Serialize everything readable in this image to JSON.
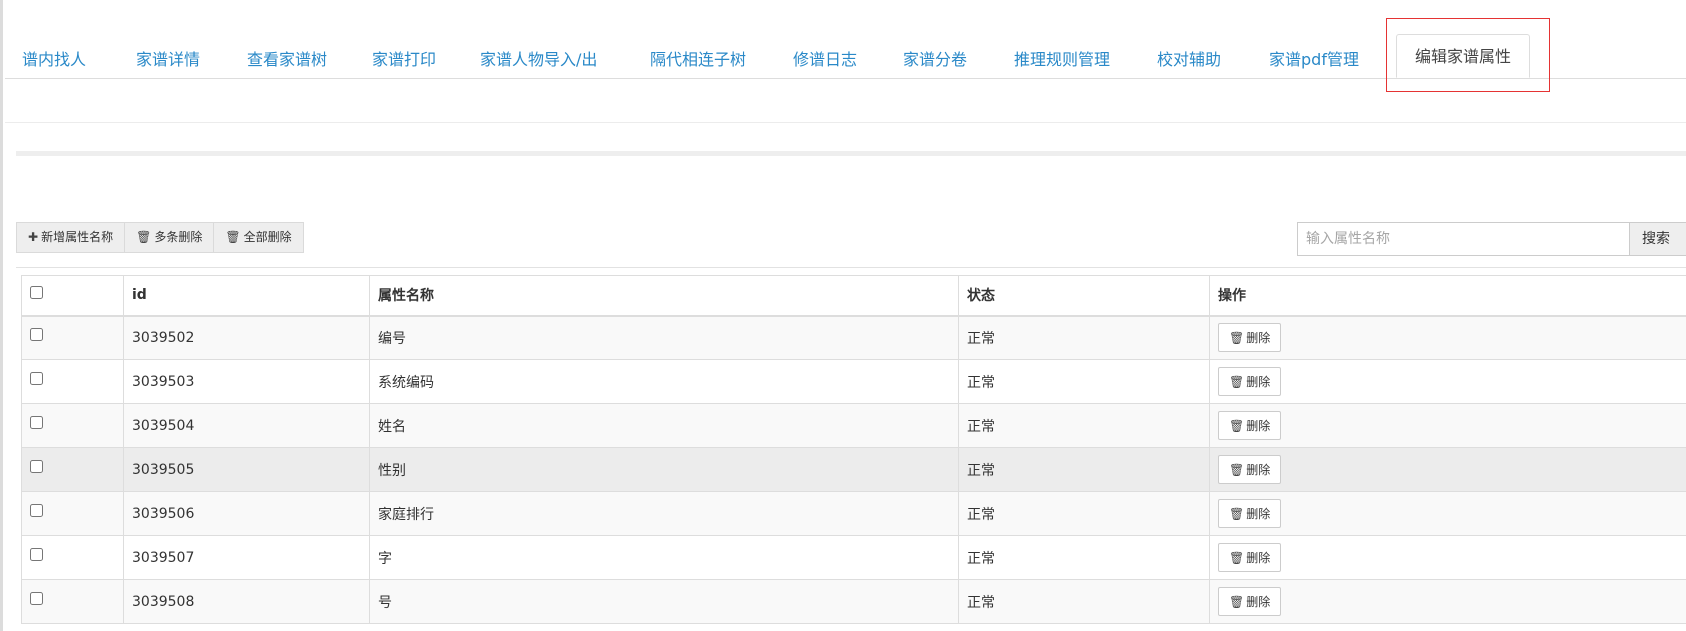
{
  "tabs": [
    {
      "label": "谱内找人",
      "active": false
    },
    {
      "label": "家谱详情",
      "active": false
    },
    {
      "label": "查看家谱树",
      "active": false
    },
    {
      "label": "家谱打印",
      "active": false
    },
    {
      "label": "家谱人物导入/出",
      "active": false
    },
    {
      "label": "隔代相连子树",
      "active": false
    },
    {
      "label": "修谱日志",
      "active": false
    },
    {
      "label": "家谱分卷",
      "active": false
    },
    {
      "label": "推理规则管理",
      "active": false
    },
    {
      "label": "校对辅助",
      "active": false
    },
    {
      "label": "家谱pdf管理",
      "active": false
    },
    {
      "label": "编辑家谱属性",
      "active": true
    }
  ],
  "toolbar": {
    "add_label": "新增属性名称",
    "add_icon": "plus-icon",
    "multi_delete_label": "多条删除",
    "multi_delete_icon": "trash-icon",
    "delete_all_label": "全部删除",
    "delete_all_icon": "trash-icon"
  },
  "search": {
    "placeholder": "输入属性名称",
    "value": "",
    "button_label": "搜索"
  },
  "table": {
    "headers": {
      "id": "id",
      "name": "属性名称",
      "status": "状态",
      "action": "操作"
    },
    "rows": [
      {
        "id": "3039502",
        "name": "编号",
        "status": "正常",
        "action": "删除"
      },
      {
        "id": "3039503",
        "name": "系统编码",
        "status": "正常",
        "action": "删除"
      },
      {
        "id": "3039504",
        "name": "姓名",
        "status": "正常",
        "action": "删除"
      },
      {
        "id": "3039505",
        "name": "性别",
        "status": "正常",
        "action": "删除"
      },
      {
        "id": "3039506",
        "name": "家庭排行",
        "status": "正常",
        "action": "删除"
      },
      {
        "id": "3039507",
        "name": "字",
        "status": "正常",
        "action": "删除"
      },
      {
        "id": "3039508",
        "name": "号",
        "status": "正常",
        "action": "删除"
      }
    ]
  },
  "colors": {
    "tab_link": "#2a89c8",
    "highlight_border": "#e53333",
    "hover_row": "#ececec"
  }
}
